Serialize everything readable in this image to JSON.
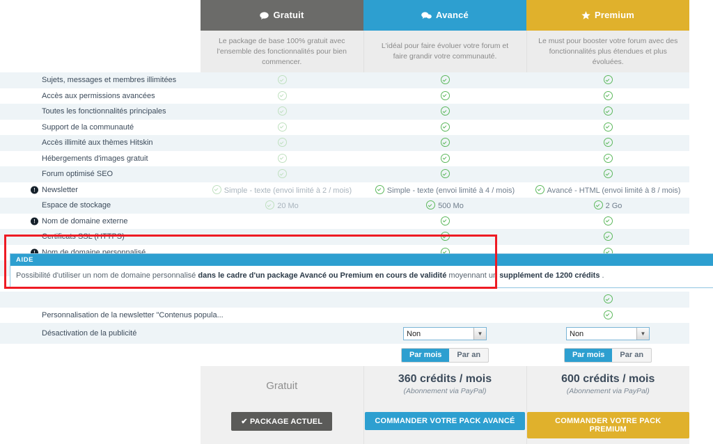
{
  "plans": [
    {
      "id": "gratuit",
      "name": "Gratuit",
      "icon": "speech-bubble-icon",
      "description": "Le package de base 100% gratuit avec l'ensemble des fonctionnalités pour bien commencer.",
      "color": "#6b6b69"
    },
    {
      "id": "avance",
      "name": "Avancé",
      "icon": "double-speech-bubble-icon",
      "description": "L'idéal pour faire évoluer votre forum et faire grandir votre communauté.",
      "color": "#2d9fd0"
    },
    {
      "id": "premium",
      "name": "Premium",
      "icon": "star-icon",
      "description": "Le must pour booster votre forum avec des fonctionnalités plus étendues et plus évoluées.",
      "color": "#e0b12c"
    }
  ],
  "features": [
    {
      "label": "Sujets, messages et membres illimitées",
      "info": false,
      "gratuit": "check",
      "avance": "check",
      "premium": "check"
    },
    {
      "label": "Accès aux permissions avancées",
      "info": false,
      "gratuit": "check",
      "avance": "check",
      "premium": "check"
    },
    {
      "label": "Toutes les fonctionnalités principales",
      "info": false,
      "gratuit": "check",
      "avance": "check",
      "premium": "check"
    },
    {
      "label": "Support de la communauté",
      "info": false,
      "gratuit": "check",
      "avance": "check",
      "premium": "check"
    },
    {
      "label": "Accès illimité aux thèmes Hitskin",
      "info": false,
      "gratuit": "check",
      "avance": "check",
      "premium": "check"
    },
    {
      "label": "Hébergements d'images gratuit",
      "info": false,
      "gratuit": "check",
      "avance": "check",
      "premium": "check"
    },
    {
      "label": "Forum optimisé SEO",
      "info": false,
      "gratuit": "check",
      "avance": "check",
      "premium": "check"
    },
    {
      "label": "Newsletter",
      "info": true,
      "gratuit": "Simple - texte (envoi limité à 2 / mois)",
      "avance": "Simple - texte (envoi limité à 4 / mois)",
      "premium": "Avancé - HTML (envoi limité à 8 / mois)"
    },
    {
      "label": "Espace de stockage",
      "info": false,
      "gratuit": "20 Mo",
      "avance": "500 Mo",
      "premium": "2 Go"
    },
    {
      "label": "Nom de domaine externe",
      "info": true,
      "gratuit": "",
      "avance": "check",
      "premium": "check"
    },
    {
      "label": "Certificats SSL (HTTPS)",
      "info": false,
      "gratuit": "",
      "avance": "check",
      "premium": "check"
    },
    {
      "label": "Nom de domaine personnalisé",
      "info": true,
      "gratuit": "",
      "avance": "check",
      "premium": "check"
    },
    {
      "label": "",
      "info": false,
      "gratuit": "",
      "avance": "",
      "premium": "check-pale"
    },
    {
      "label": "",
      "info": false,
      "gratuit": "",
      "avance": "",
      "premium": "check"
    },
    {
      "label": "",
      "info": false,
      "gratuit": "",
      "avance": "",
      "premium": "check"
    },
    {
      "label": "Personnalisation de la newsletter \"Contenus popula...",
      "info": false,
      "gratuit": "",
      "avance": "",
      "premium": "check"
    },
    {
      "label": "Désactivation de la publicité",
      "info": false,
      "gratuit": "",
      "avance": "select",
      "premium": "select"
    }
  ],
  "select": {
    "value": "Non",
    "arrow": "chevron-down-icon"
  },
  "billing_toggle": {
    "monthly": "Par mois",
    "yearly": "Par an",
    "active": "Par mois"
  },
  "pricing": {
    "gratuit_label": "Gratuit",
    "avance_amount": "360 crédits / mois",
    "avance_sub": "(Abonnement via PayPal)",
    "premium_amount": "600 crédits / mois",
    "premium_sub": "(Abonnement via PayPal)"
  },
  "buttons": {
    "current": "✔ PACKAGE ACTUEL",
    "order_avance": "COMMANDER VOTRE PACK AVANCÉ",
    "order_premium": "COMMANDER VOTRE PACK PREMIUM"
  },
  "tooltip": {
    "title": "AIDE",
    "part1": "Possibilité d'utiliser un nom de domaine personnalisé ",
    "bold1": "dans le cadre d'un package Avancé ou Premium en cours de validité",
    "part2": " moyennant un ",
    "bold2": "supplément de 1200 crédits",
    "part3": " ."
  },
  "annotation": {
    "color": "#ee1b24"
  }
}
